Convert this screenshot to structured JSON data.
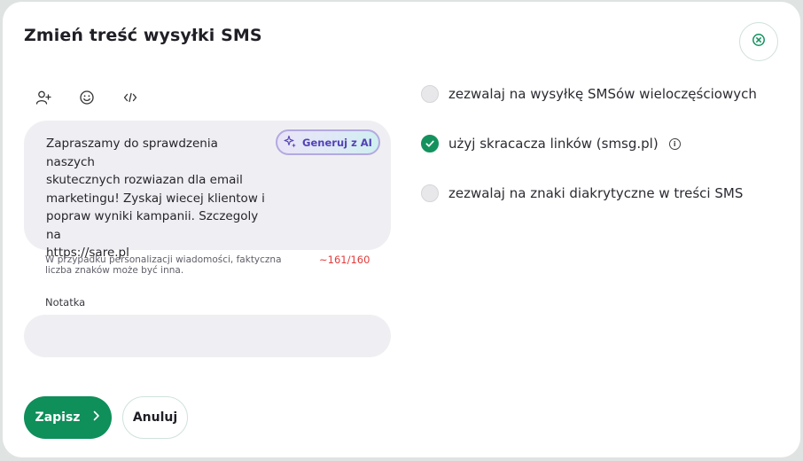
{
  "modal": {
    "title": "Zmień treść wysyłki SMS"
  },
  "toolbar": {
    "icons": [
      "add-person-icon",
      "emoji-icon",
      "code-icon"
    ]
  },
  "message": {
    "text": "Zapraszamy do sprawdzenia naszych\nskutecznych rozwiazan dla email\nmarketingu! Zyskaj wiecej klientow i\npopraw wyniki kampanii. Szczegoly na\nhttps://sare.pl",
    "ai_button_label": "Generuj z AI",
    "hint": "W przypadku personalizacji wiadomości, faktyczna liczba znaków może być inna.",
    "counter": "~161/160"
  },
  "note": {
    "label": "Notatka",
    "value": "",
    "placeholder": ""
  },
  "options": [
    {
      "label": "zezwalaj na wysyłkę SMSów wieloczęściowych",
      "checked": false
    },
    {
      "label": "użyj skracacza linków (smsg.pl)",
      "checked": true
    },
    {
      "label": "zezwalaj na znaki diakrytyczne w treści SMS",
      "checked": false
    }
  ],
  "actions": {
    "save_label": "Zapisz",
    "cancel_label": "Anuluj"
  },
  "colors": {
    "primary": "#0f8f5a",
    "counter_error": "#e23b3b",
    "ai_accent": "#5342b6",
    "field_background": "#efeff3"
  }
}
